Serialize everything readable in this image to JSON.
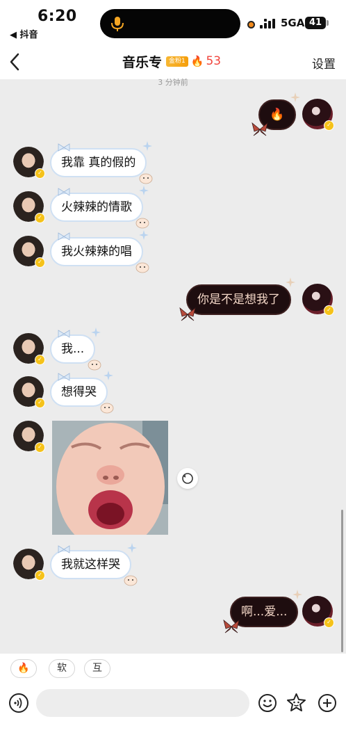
{
  "status_bar": {
    "time": "6:20",
    "back_app": "◀ 抖音",
    "network": "5GA",
    "battery": "41"
  },
  "header": {
    "title": "音乐专",
    "fan_badge": "金粉1",
    "fire_count": "53",
    "settings_label": "设置"
  },
  "timestamp": "3 分钟前",
  "messages": [
    {
      "side": "right",
      "type": "emoji",
      "text": "🔥"
    },
    {
      "side": "left",
      "type": "text",
      "text": "我靠 真的假的"
    },
    {
      "side": "left",
      "type": "text",
      "text": "火辣辣的情歌"
    },
    {
      "side": "left",
      "type": "text",
      "text": "我火辣辣的唱"
    },
    {
      "side": "right",
      "type": "text",
      "text": "你是不是想我了"
    },
    {
      "side": "left",
      "type": "text",
      "text": "我..."
    },
    {
      "side": "left",
      "type": "text",
      "text": "想得哭"
    },
    {
      "side": "left",
      "type": "image"
    },
    {
      "side": "left",
      "type": "text",
      "text": "我就这样哭"
    },
    {
      "side": "right",
      "type": "text",
      "text": "啊...爱..."
    }
  ],
  "quick_replies": [
    {
      "label": "🔥"
    },
    {
      "label": "软"
    },
    {
      "label": "互"
    }
  ],
  "input": {
    "placeholder": ""
  },
  "colors": {
    "fire": "#f1453d",
    "left_bubble_border": "#cfe0f3",
    "right_bubble_bg": "#1e0d0f",
    "right_bubble_text": "#f2d6c6",
    "badge_gold": "#f5c21a"
  }
}
